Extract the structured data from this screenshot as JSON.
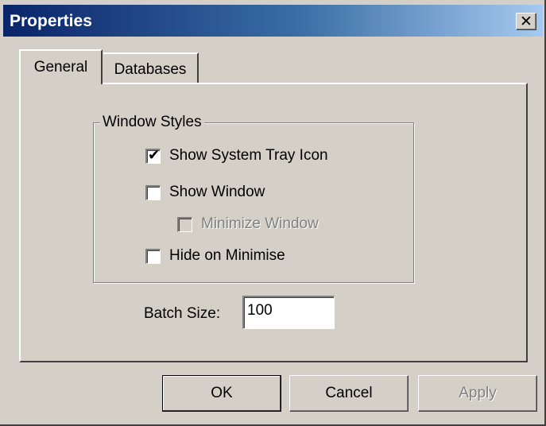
{
  "window": {
    "title": "Properties",
    "close_glyph": "✕",
    "close_icon": "close-icon"
  },
  "tabs": [
    {
      "label": "General",
      "selected": true
    },
    {
      "label": "Databases",
      "selected": false
    }
  ],
  "group": {
    "title": "Window Styles",
    "options": [
      {
        "label": "Show System Tray Icon",
        "checked": true,
        "enabled": true
      },
      {
        "label": "Show Window",
        "checked": false,
        "enabled": true
      },
      {
        "label": "Minimize Window",
        "checked": false,
        "enabled": false
      },
      {
        "label": "Hide on Minimise",
        "checked": false,
        "enabled": true
      }
    ]
  },
  "batch": {
    "label": "Batch Size:",
    "value": "100"
  },
  "buttons": {
    "ok": "OK",
    "cancel": "Cancel",
    "apply": "Apply",
    "apply_enabled": false
  },
  "colors": {
    "title_gradient_start": "#0a246a",
    "title_gradient_end": "#a6caf0",
    "face": "#d4d0c8",
    "disabled_text": "#808080"
  }
}
